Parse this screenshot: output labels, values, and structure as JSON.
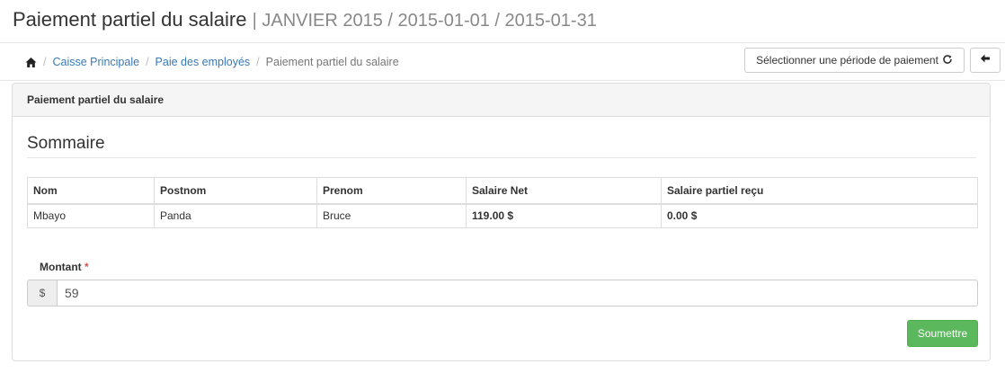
{
  "header": {
    "title": "Paiement partiel du salaire",
    "subtitle": "| JANVIER 2015 / 2015-01-01 / 2015-01-31"
  },
  "breadcrumb": {
    "home_icon": "home-icon",
    "items": [
      "Caisse Principale",
      "Paie des employés"
    ],
    "active": "Paiement partiel du salaire"
  },
  "toolbar": {
    "period_button_label": "Sélectionner une période de paiement",
    "period_button_icon": "refresh-icon",
    "back_button_icon": "arrow-left-icon"
  },
  "panel": {
    "heading": "Paiement partiel du salaire",
    "section_title": "Sommaire"
  },
  "table": {
    "columns": [
      "Nom",
      "Postnom",
      "Prenom",
      "Salaire Net",
      "Salaire partiel reçu"
    ],
    "rows": [
      [
        "Mbayo",
        "Panda",
        "Bruce",
        "119.00 $",
        "0.00 $"
      ]
    ]
  },
  "form": {
    "amount_label": "Montant",
    "required_marker": "*",
    "currency_addon": "$",
    "amount_value": "59",
    "submit_label": "Soumettre"
  },
  "colors": {
    "link": "#3a79b5",
    "submit": "#5cb85c",
    "required": "#d9534f"
  }
}
